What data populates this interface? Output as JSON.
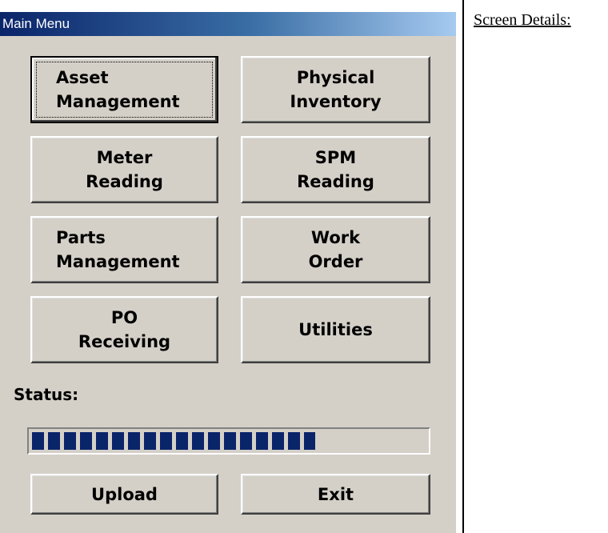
{
  "window": {
    "title": "Main Menu"
  },
  "menu": {
    "buttons": [
      {
        "name": "asset-management-button",
        "label": "Asset\nManagement",
        "align": "left",
        "focused": true
      },
      {
        "name": "physical-inventory-button",
        "label": "Physical\nInventory",
        "align": "center",
        "focused": false
      },
      {
        "name": "meter-reading-button",
        "label": "Meter\nReading",
        "align": "center",
        "focused": false
      },
      {
        "name": "spm-reading-button",
        "label": "SPM\nReading",
        "align": "center",
        "focused": false
      },
      {
        "name": "parts-management-button",
        "label": "Parts\nManagement",
        "align": "left",
        "focused": false
      },
      {
        "name": "work-order-button",
        "label": "Work\nOrder",
        "align": "center",
        "focused": false
      },
      {
        "name": "po-receiving-button",
        "label": "PO\nReceiving",
        "align": "center",
        "focused": false
      },
      {
        "name": "utilities-button",
        "label": "Utilities",
        "align": "center",
        "focused": false
      }
    ]
  },
  "status": {
    "label": "Status:",
    "progress_fraction": 0.72,
    "bar_color": "#0a246a"
  },
  "footer": {
    "upload_label": "Upload",
    "exit_label": "Exit"
  },
  "side_panel": {
    "heading": "Screen Details:"
  },
  "colors": {
    "window_bg": "#d4d0c8",
    "title_start": "#0a246a",
    "title_end": "#a6caf0"
  }
}
